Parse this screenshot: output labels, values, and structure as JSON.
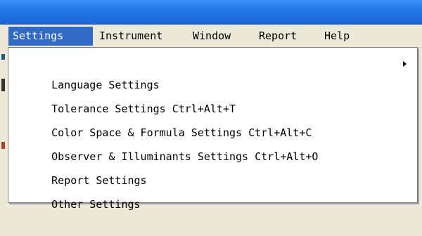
{
  "menubar": {
    "items": [
      {
        "label": "Settings",
        "active": true
      },
      {
        "label": "Instrument",
        "active": false
      },
      {
        "label": "Window",
        "active": false
      },
      {
        "label": "Report",
        "active": false
      },
      {
        "label": "Help",
        "active": false
      }
    ]
  },
  "settings_menu": {
    "items": [
      {
        "label": "Language Settings",
        "has_submenu": true
      },
      {
        "label": "Tolerance Settings Ctrl+Alt+T",
        "has_submenu": false
      },
      {
        "label": "Color Space & Formula Settings Ctrl+Alt+C",
        "has_submenu": false
      },
      {
        "label": "Observer & Illuminants Settings Ctrl+Alt+O",
        "has_submenu": false
      },
      {
        "label": "Report Settings",
        "has_submenu": false
      },
      {
        "label": "Other Settings",
        "has_submenu": false
      }
    ]
  },
  "colors": {
    "titlebar": "#1d6fe0",
    "menu_highlight": "#316ac5",
    "menubar_bg": "#ece9d8",
    "dropdown_bg": "#ffffff"
  }
}
